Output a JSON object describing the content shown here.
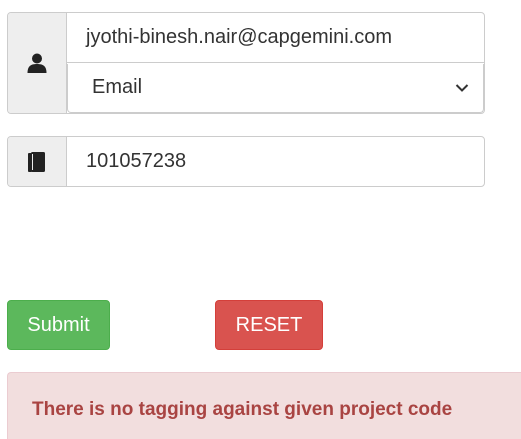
{
  "user": {
    "email_value": "jyothi-binesh.nair@capgemini.com",
    "type_select_value": "Email",
    "user_icon": "user-icon",
    "chevron_icon": "chevron-down-icon"
  },
  "project": {
    "code_value": "101057238",
    "book_icon": "book-icon"
  },
  "buttons": {
    "submit_label": "Submit",
    "reset_label": "RESET"
  },
  "alert": {
    "message": "There is no tagging against given project code"
  },
  "colors": {
    "success": "#5cb85c",
    "danger": "#d9534f",
    "alert_bg": "#f2dede",
    "alert_text": "#a94442"
  }
}
